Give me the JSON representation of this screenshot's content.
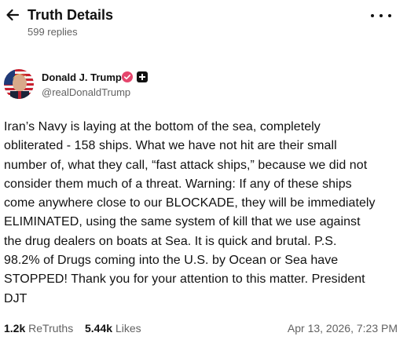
{
  "header": {
    "title": "Truth Details",
    "reply_count": "599 replies"
  },
  "author": {
    "name": "Donald J. Trump",
    "handle": "@realDonaldTrump"
  },
  "post": {
    "lines": [
      "Iran’s Navy is laying at the bottom of the sea, completely",
      "obliterated - 158 ships. What we have not hit are their small",
      "number of, what they call, “fast attack ships,” because we did not",
      "consider them much of a threat. Warning: If any of these ships",
      "come anywhere close to our BLOCKADE, they will be immediately",
      "ELIMINATED, using the same system of kill that we use against",
      "the drug dealers on boats at Sea. It is quick and brutal. P.S.",
      "98.2% of Drugs coming into the U.S. by Ocean or Sea have",
      "STOPPED! Thank you for your attention to this matter. President",
      "DJT"
    ]
  },
  "stats": {
    "retruths_count": "1.2k",
    "retruths_label": "ReTruths",
    "likes_count": "5.44k",
    "likes_label": "Likes",
    "timestamp": "Apr 13, 2026, 7:23 PM"
  },
  "icons": {
    "back": "arrow-left-icon",
    "more": "more-horizontal-icon",
    "verified": "verified-badge-icon",
    "plus": "plus-badge-icon"
  },
  "colors": {
    "verified_badge": "#e5466d",
    "secondary_text": "#626262"
  }
}
